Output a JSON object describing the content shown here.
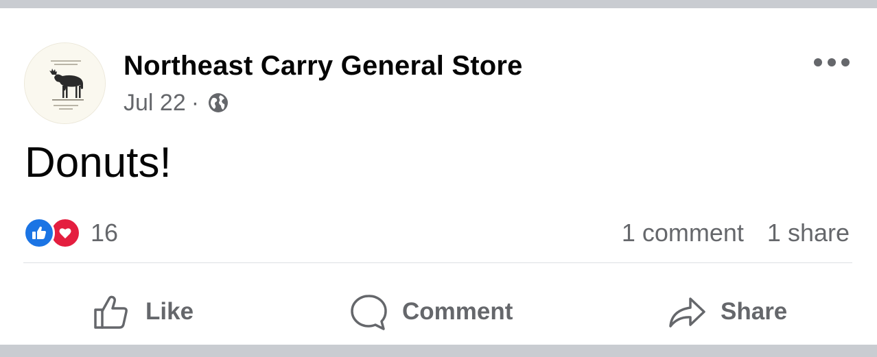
{
  "post": {
    "author": "Northeast Carry General Store",
    "date": "Jul 22",
    "separator": "·",
    "privacy_icon": "globe-icon",
    "text": "Donuts!",
    "reactions": {
      "types": [
        "like",
        "love"
      ],
      "count": "16",
      "like_color": "#1b74e4",
      "love_color": "#e41e3f"
    },
    "comments_count": "1 comment",
    "shares_count": "1 share"
  },
  "actions": {
    "like_label": "Like",
    "comment_label": "Comment",
    "share_label": "Share"
  },
  "colors": {
    "text_primary": "#050505",
    "text_secondary": "#65676b",
    "page_background": "#c9ccd1",
    "card_background": "#ffffff"
  }
}
